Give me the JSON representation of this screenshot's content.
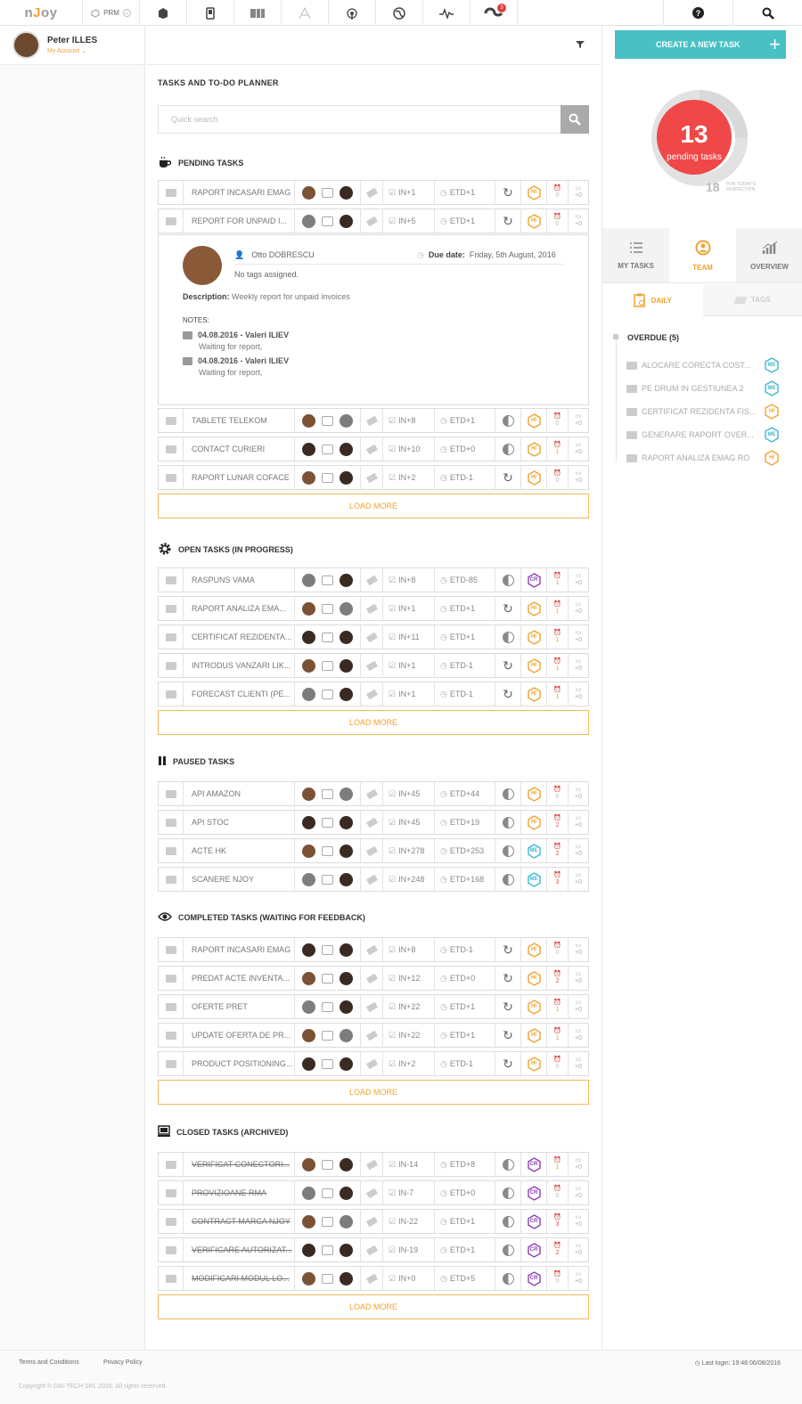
{
  "topbar": {
    "logo_prefix": "n",
    "logo_mid": "J",
    "logo_suffix": "oy",
    "module": "PRM",
    "notification_count": "3"
  },
  "user": {
    "name": "Peter ILLES",
    "account": "My Account"
  },
  "page_title": "TASKS AND TO-DO PLANNER",
  "search": {
    "placeholder": "Quick search"
  },
  "create_button": "CREATE A NEW TASK",
  "load_more": "LOAD MORE",
  "summary": {
    "pending_count": "13",
    "pending_label": "pending tasks",
    "perfection_count": "18",
    "perfection_label_1": "FOR TODAY'S",
    "perfection_label_2": "PERFECTION"
  },
  "right_tabs": [
    "MY TASKS",
    "TEAM",
    "OVERVIEW"
  ],
  "sub_tabs": [
    "DAILY",
    "TAGS"
  ],
  "overdue": {
    "title": "OVERDUE (5)",
    "items": [
      {
        "name": "ALOCARE CORECTA COST...",
        "prio": "ME"
      },
      {
        "name": "PE DRUM IN GESTIUNEA 2",
        "prio": "ME"
      },
      {
        "name": "CERTIFICAT REZIDENTA FIS...",
        "prio": "HI"
      },
      {
        "name": "GENERARE RAPORT OVER...",
        "prio": "ME"
      },
      {
        "name": "RAPORT ANALIZA EMAG RO",
        "prio": "HI"
      }
    ]
  },
  "expanded": {
    "assignee": "Otto DOBRESCU",
    "due_label": "Due date:",
    "due_value": "Friday, 5th August, 2016",
    "tags": "No tags assigned.",
    "desc_label": "Description:",
    "desc_value": "Weekly report for unpaid invoices",
    "notes_label": "NOTES:",
    "notes": [
      {
        "header": "04.08.2016 - Valeri ILIEV",
        "text": "Waiting for report,"
      },
      {
        "header": "04.08.2016 - Valeri ILIEV",
        "text": "Waiting for report,"
      }
    ]
  },
  "sections": [
    {
      "title": "PENDING TASKS",
      "rows": [
        {
          "name": "RAPORT INCASARI EMAG",
          "in": "IN+1",
          "etd": "ETD+1",
          "prio": "HI",
          "alarm": "0",
          "flag": "+0",
          "state": "refresh"
        },
        {
          "name": "REPORT FOR UNPAID I...",
          "in": "IN+5",
          "etd": "ETD+1",
          "prio": "HI",
          "alarm": "0",
          "flag": "+0",
          "state": "refresh"
        },
        {
          "name": "TABLETE TELEKOM",
          "in": "IN+8",
          "etd": "ETD+1",
          "prio": "HI",
          "alarm": "0",
          "flag": "+0",
          "state": "moon"
        },
        {
          "name": "CONTACT CURIERI",
          "in": "IN+10",
          "etd": "ETD+0",
          "prio": "HI",
          "alarm": "1",
          "flag": "+0",
          "state": "moon"
        },
        {
          "name": "RAPORT LUNAR COFACE",
          "in": "IN+2",
          "etd": "ETD-1",
          "prio": "HI",
          "alarm": "0",
          "flag": "+0",
          "state": "refresh"
        }
      ]
    },
    {
      "title": "OPEN TASKS (IN PROGRESS)",
      "rows": [
        {
          "name": "RASPUNS VAMA",
          "in": "IN+8",
          "etd": "ETD-85",
          "prio": "CR",
          "alarm": "1",
          "flag": "+0",
          "state": "moon"
        },
        {
          "name": "RAPORT ANALIZA EMA...",
          "in": "IN+1",
          "etd": "ETD+1",
          "prio": "HI",
          "alarm": "1",
          "flag": "+0",
          "state": "refresh"
        },
        {
          "name": "CERTIFICAT REZIDENTA...",
          "in": "IN+11",
          "etd": "ETD+1",
          "prio": "HI",
          "alarm": "1",
          "flag": "+0",
          "state": "moon"
        },
        {
          "name": "INTRODUS VANZARI LIK...",
          "in": "IN+1",
          "etd": "ETD-1",
          "prio": "HI",
          "alarm": "1",
          "flag": "+0",
          "state": "refresh"
        },
        {
          "name": "FORECAST CLIENTI (PE...",
          "in": "IN+1",
          "etd": "ETD-1",
          "prio": "HI",
          "alarm": "1",
          "flag": "+0",
          "state": "refresh"
        }
      ]
    },
    {
      "title": "PAUSED TASKS",
      "rows": [
        {
          "name": "API AMAZON",
          "in": "IN+45",
          "etd": "ETD+44",
          "prio": "HI",
          "alarm": "0",
          "flag": "+0",
          "state": "moon"
        },
        {
          "name": "API STOC",
          "in": "IN+45",
          "etd": "ETD+19",
          "prio": "HI",
          "alarm": "2",
          "flag": "+0",
          "state": "moon"
        },
        {
          "name": "ACTE HK",
          "in": "IN+278",
          "etd": "ETD+253",
          "prio": "ME",
          "alarm": "2",
          "flag": "+0",
          "state": "moon"
        },
        {
          "name": "SCANERE NJOY",
          "in": "IN+248",
          "etd": "ETD+168",
          "prio": "ME",
          "alarm": "3",
          "flag": "+0",
          "state": "moon"
        }
      ]
    },
    {
      "title": "COMPLETED TASKS (WAITING FOR FEEDBACK)",
      "rows": [
        {
          "name": "RAPORT INCASARI EMAG",
          "in": "IN+8",
          "etd": "ETD-1",
          "prio": "HI",
          "alarm": "0",
          "flag": "+0",
          "state": "refresh"
        },
        {
          "name": "PREDAT ACTE INVENTA...",
          "in": "IN+12",
          "etd": "ETD+0",
          "prio": "HI",
          "alarm": "2",
          "flag": "+0",
          "state": "refresh"
        },
        {
          "name": "OFERTE PRET",
          "in": "IN+22",
          "etd": "ETD+1",
          "prio": "HI",
          "alarm": "1",
          "flag": "+0",
          "state": "refresh"
        },
        {
          "name": "UPDATE OFERTA DE PR...",
          "in": "IN+22",
          "etd": "ETD+1",
          "prio": "HI",
          "alarm": "1",
          "flag": "+0",
          "state": "refresh"
        },
        {
          "name": "PRODUCT POSITIONING...",
          "in": "IN+2",
          "etd": "ETD-1",
          "prio": "HI",
          "alarm": "0",
          "flag": "+0",
          "state": "refresh"
        }
      ]
    },
    {
      "title": "CLOSED TASKS (ARCHIVED)",
      "rows": [
        {
          "name": "VERIFICAT CONECTORI...",
          "in": "IN-14",
          "etd": "ETD+8",
          "prio": "CR",
          "alarm": "1",
          "flag": "+0",
          "state": "moon"
        },
        {
          "name": "PROVIZIOANE RMA",
          "in": "IN-7",
          "etd": "ETD+0",
          "prio": "CR",
          "alarm": "0",
          "flag": "+0",
          "state": "moon"
        },
        {
          "name": "CONTRACT MARCA NJOY",
          "in": "IN-22",
          "etd": "ETD+1",
          "prio": "CR",
          "alarm": "3",
          "flag": "+0",
          "state": "moon"
        },
        {
          "name": "VERIFICARE AUTORIZAT...",
          "in": "IN-19",
          "etd": "ETD+1",
          "prio": "CR",
          "alarm": "2",
          "flag": "+0",
          "state": "moon"
        },
        {
          "name": "MODIFICARI MODUL LO...",
          "in": "IN+0",
          "etd": "ETD+5",
          "prio": "CR",
          "alarm": "0",
          "flag": "+0",
          "state": "moon"
        }
      ]
    }
  ],
  "colors": {
    "accent": "#f0a22e",
    "teal": "#48c0c4",
    "red": "#e84545",
    "hi": "#f0a22e",
    "me": "#3bb8d4",
    "cr": "#8b3fb5",
    "alarm_red": "#e05050"
  },
  "footer": {
    "terms": "Terms and Conditions",
    "privacy": "Privacy Policy",
    "last_login": "Last login: 19:48 06/08/2016",
    "copyright": "Copyright © DAI-TECH SRL 2016. All rights reserved."
  }
}
